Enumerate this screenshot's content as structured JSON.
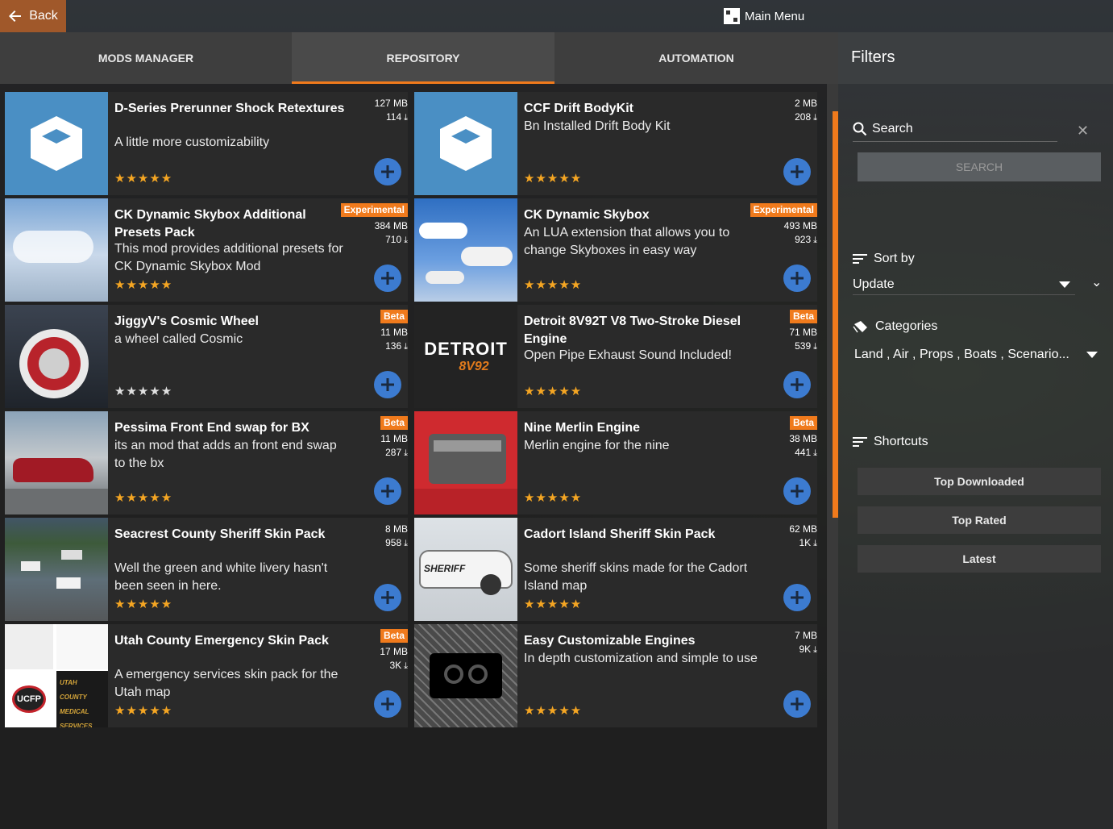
{
  "topbar": {
    "back_label": "Back",
    "main_menu_label": "Main Menu"
  },
  "tabs": [
    {
      "label": "MODS MANAGER"
    },
    {
      "label": "REPOSITORY",
      "active": true
    },
    {
      "label": "AUTOMATION"
    }
  ],
  "mods": [
    {
      "title": "D-Series Prerunner Shock Retextures",
      "desc": "A little more customizability",
      "size": "127 MB",
      "downloads": "114",
      "badge": "",
      "rating": 5,
      "thumb": "box-icon"
    },
    {
      "title": "CCF Drift BodyKit",
      "desc": "Bn Installed Drift Body Kit",
      "size": "2 MB",
      "downloads": "208",
      "badge": "",
      "rating": 5,
      "thumb": "box-icon"
    },
    {
      "title": "CK Dynamic Skybox Additional Presets Pack",
      "desc": "This mod provides additional presets for CK Dynamic Skybox Mod",
      "size": "384 MB",
      "downloads": "710",
      "badge": "Experimental",
      "rating": 5,
      "thumb": "sky"
    },
    {
      "title": "CK Dynamic Skybox",
      "desc": "An LUA extension that allows you to change Skyboxes in easy way",
      "size": "493 MB",
      "downloads": "923",
      "badge": "Experimental",
      "rating": 5,
      "thumb": "sky2"
    },
    {
      "title": "JiggyV's Cosmic Wheel",
      "desc": "a wheel called Cosmic",
      "size": "11 MB",
      "downloads": "136",
      "badge": "Beta",
      "rating": 0,
      "thumb": "wheel"
    },
    {
      "title": "Detroit 8V92T V8 Two-Stroke Diesel Engine",
      "desc": "Open Pipe Exhaust Sound Included!",
      "size": "71 MB",
      "downloads": "539",
      "badge": "Beta",
      "rating": 5,
      "thumb": "detroit",
      "thumb_text": "DETROIT",
      "thumb_sub": "8V92"
    },
    {
      "title": "Pessima Front End swap for BX",
      "desc": "its an mod that adds an front end swap to the bx",
      "size": "11 MB",
      "downloads": "287",
      "badge": "Beta",
      "rating": 5,
      "thumb": "car-red"
    },
    {
      "title": "Nine Merlin Engine",
      "desc": "Merlin engine for the nine",
      "size": "38 MB",
      "downloads": "441",
      "badge": "Beta",
      "rating": 5,
      "thumb": "engine-red"
    },
    {
      "title": "Seacrest County Sheriff Skin Pack",
      "desc": "Well the green and white livery hasn't been seen in here.",
      "size": "8 MB",
      "downloads": "958",
      "badge": "",
      "rating": 5,
      "thumb": "police-field"
    },
    {
      "title": "Cadort Island Sheriff Skin Pack",
      "desc": "Some sheriff skins made for the Cadort Island map",
      "size": "62 MB",
      "downloads": "1K",
      "badge": "",
      "rating": 5,
      "thumb": "sheriff-car",
      "thumb_text": "SHERIFF"
    },
    {
      "title": "Utah County Emergency Skin Pack",
      "desc": "A emergency services skin pack for the Utah map",
      "size": "17 MB",
      "downloads": "3K",
      "badge": "Beta",
      "rating": 5,
      "thumb": "badges",
      "thumb_text": "UCFP",
      "thumb_sub": "UTAH COUNTY MEDICAL SERVICES"
    },
    {
      "title": "Easy Customizable Engines",
      "desc": "In depth customization and simple to use",
      "size": "7 MB",
      "downloads": "9K",
      "badge": "",
      "rating": 5,
      "thumb": "engine-icon"
    }
  ],
  "filters": {
    "title": "Filters",
    "search_placeholder": "Search",
    "search_button": "SEARCH",
    "sort_label": "Sort by",
    "sort_value": "Update",
    "categories_label": "Categories",
    "categories_value": "Land , Air , Props , Boats , Scenario...",
    "shortcuts_label": "Shortcuts",
    "shortcuts": [
      "Top Downloaded",
      "Top Rated",
      "Latest"
    ]
  },
  "colors": {
    "accent": "#f07a1c",
    "add_button": "#3c7bd0",
    "back_button": "#a0582a",
    "star": "#f5a623"
  }
}
